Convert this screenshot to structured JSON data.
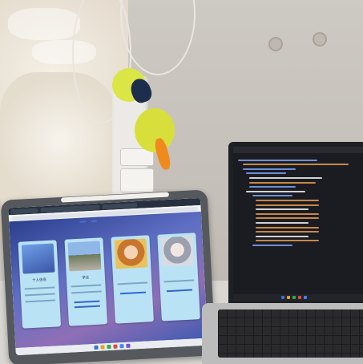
{
  "scene": {
    "description_free": true
  },
  "tablet": {
    "tabs": [
      "",
      "",
      ""
    ],
    "nav": [
      "",
      ""
    ],
    "cards": [
      {
        "title": "个人信息"
      },
      {
        "title": "学业"
      },
      {
        "title": ""
      },
      {
        "title": ""
      }
    ]
  },
  "laptop": {},
  "colors": {
    "wall": "#c3beb7",
    "duck": "#d8df3a",
    "beak": "#f08a1c",
    "tablet_page": "#415bb0",
    "card": "#b9e3f4",
    "code_bg": "#1b1c22"
  }
}
